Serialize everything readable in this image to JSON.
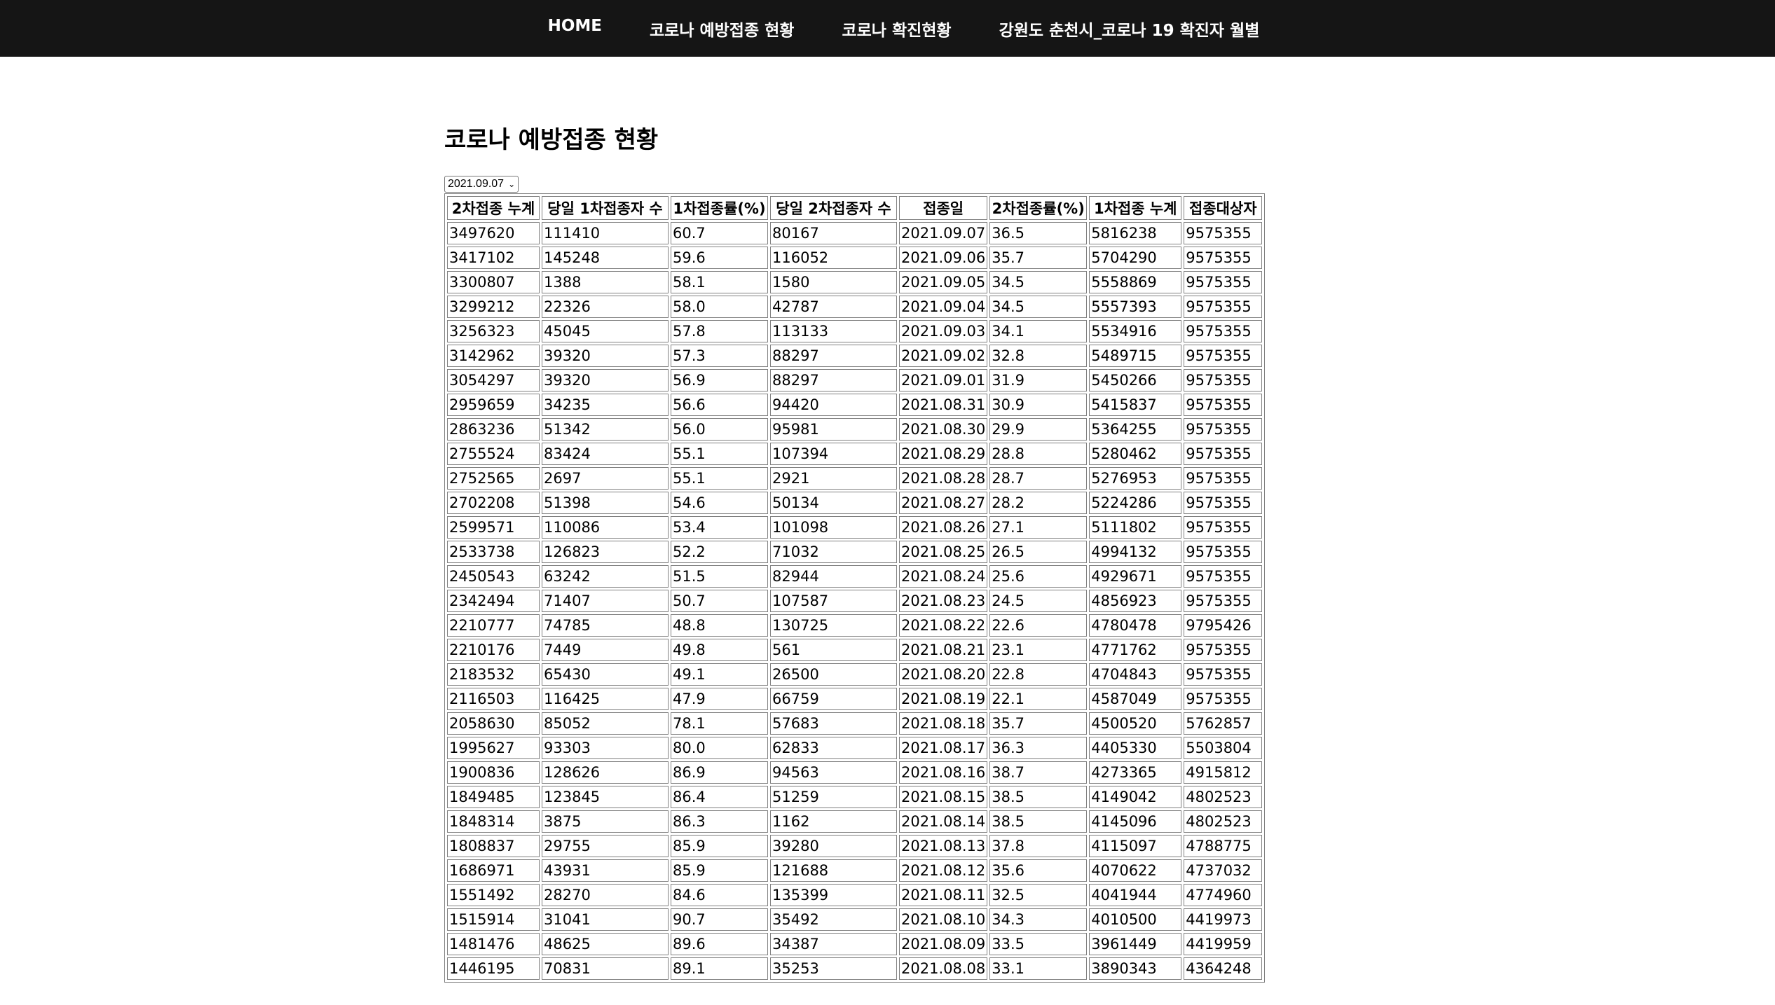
{
  "nav": {
    "items": [
      {
        "label": "HOME"
      },
      {
        "label": "코로나 예방접종 현황"
      },
      {
        "label": "코로나 확진현황"
      },
      {
        "label": "강원도 춘천시_코로나 19 확진자 월별"
      }
    ]
  },
  "page": {
    "title": "코로나 예방접종 현황",
    "date_select": {
      "selected": "2021.09.07"
    }
  },
  "table": {
    "headers": [
      "2차접종 누계",
      "당일 1차접종자 수",
      "1차접종률(%)",
      "당일 2차접종자 수",
      "접종일",
      "2차접종률(%)",
      "1차접종 누계",
      "접종대상자"
    ],
    "rows": [
      [
        "3497620",
        "111410",
        "60.7",
        "80167",
        "2021.09.07",
        "36.5",
        "5816238",
        "9575355"
      ],
      [
        "3417102",
        "145248",
        "59.6",
        "116052",
        "2021.09.06",
        "35.7",
        "5704290",
        "9575355"
      ],
      [
        "3300807",
        "1388",
        "58.1",
        "1580",
        "2021.09.05",
        "34.5",
        "5558869",
        "9575355"
      ],
      [
        "3299212",
        "22326",
        "58.0",
        "42787",
        "2021.09.04",
        "34.5",
        "5557393",
        "9575355"
      ],
      [
        "3256323",
        "45045",
        "57.8",
        "113133",
        "2021.09.03",
        "34.1",
        "5534916",
        "9575355"
      ],
      [
        "3142962",
        "39320",
        "57.3",
        "88297",
        "2021.09.02",
        "32.8",
        "5489715",
        "9575355"
      ],
      [
        "3054297",
        "39320",
        "56.9",
        "88297",
        "2021.09.01",
        "31.9",
        "5450266",
        "9575355"
      ],
      [
        "2959659",
        "34235",
        "56.6",
        "94420",
        "2021.08.31",
        "30.9",
        "5415837",
        "9575355"
      ],
      [
        "2863236",
        "51342",
        "56.0",
        "95981",
        "2021.08.30",
        "29.9",
        "5364255",
        "9575355"
      ],
      [
        "2755524",
        "83424",
        "55.1",
        "107394",
        "2021.08.29",
        "28.8",
        "5280462",
        "9575355"
      ],
      [
        "2752565",
        "2697",
        "55.1",
        "2921",
        "2021.08.28",
        "28.7",
        "5276953",
        "9575355"
      ],
      [
        "2702208",
        "51398",
        "54.6",
        "50134",
        "2021.08.27",
        "28.2",
        "5224286",
        "9575355"
      ],
      [
        "2599571",
        "110086",
        "53.4",
        "101098",
        "2021.08.26",
        "27.1",
        "5111802",
        "9575355"
      ],
      [
        "2533738",
        "126823",
        "52.2",
        "71032",
        "2021.08.25",
        "26.5",
        "4994132",
        "9575355"
      ],
      [
        "2450543",
        "63242",
        "51.5",
        "82944",
        "2021.08.24",
        "25.6",
        "4929671",
        "9575355"
      ],
      [
        "2342494",
        "71407",
        "50.7",
        "107587",
        "2021.08.23",
        "24.5",
        "4856923",
        "9575355"
      ],
      [
        "2210777",
        "74785",
        "48.8",
        "130725",
        "2021.08.22",
        "22.6",
        "4780478",
        "9795426"
      ],
      [
        "2210176",
        "7449",
        "49.8",
        "561",
        "2021.08.21",
        "23.1",
        "4771762",
        "9575355"
      ],
      [
        "2183532",
        "65430",
        "49.1",
        "26500",
        "2021.08.20",
        "22.8",
        "4704843",
        "9575355"
      ],
      [
        "2116503",
        "116425",
        "47.9",
        "66759",
        "2021.08.19",
        "22.1",
        "4587049",
        "9575355"
      ],
      [
        "2058630",
        "85052",
        "78.1",
        "57683",
        "2021.08.18",
        "35.7",
        "4500520",
        "5762857"
      ],
      [
        "1995627",
        "93303",
        "80.0",
        "62833",
        "2021.08.17",
        "36.3",
        "4405330",
        "5503804"
      ],
      [
        "1900836",
        "128626",
        "86.9",
        "94563",
        "2021.08.16",
        "38.7",
        "4273365",
        "4915812"
      ],
      [
        "1849485",
        "123845",
        "86.4",
        "51259",
        "2021.08.15",
        "38.5",
        "4149042",
        "4802523"
      ],
      [
        "1848314",
        "3875",
        "86.3",
        "1162",
        "2021.08.14",
        "38.5",
        "4145096",
        "4802523"
      ],
      [
        "1808837",
        "29755",
        "85.9",
        "39280",
        "2021.08.13",
        "37.8",
        "4115097",
        "4788775"
      ],
      [
        "1686971",
        "43931",
        "85.9",
        "121688",
        "2021.08.12",
        "35.6",
        "4070622",
        "4737032"
      ],
      [
        "1551492",
        "28270",
        "84.6",
        "135399",
        "2021.08.11",
        "32.5",
        "4041944",
        "4774960"
      ],
      [
        "1515914",
        "31041",
        "90.7",
        "35492",
        "2021.08.10",
        "34.3",
        "4010500",
        "4419973"
      ],
      [
        "1481476",
        "48625",
        "89.6",
        "34387",
        "2021.08.09",
        "33.5",
        "3961449",
        "4419959"
      ],
      [
        "1446195",
        "70831",
        "89.1",
        "35253",
        "2021.08.08",
        "33.1",
        "3890343",
        "4364248"
      ]
    ]
  }
}
